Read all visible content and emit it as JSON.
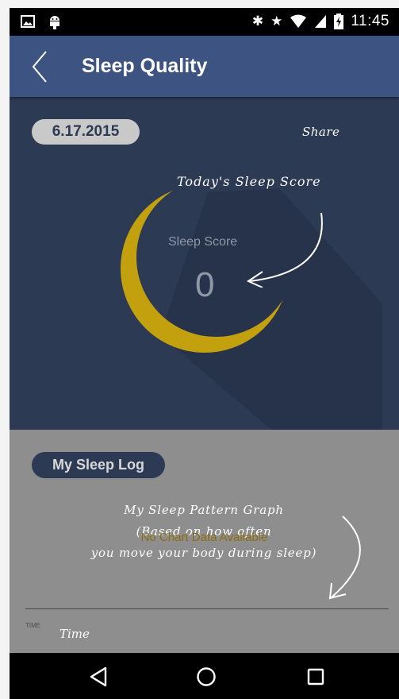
{
  "status_bar": {
    "time": "11:45",
    "icons": [
      "image-icon",
      "android-icon",
      "bluetooth-icon",
      "star-icon",
      "wifi-icon",
      "signal-icon",
      "battery-charging-icon"
    ]
  },
  "app_bar": {
    "title": "Sleep Quality",
    "back_icon": "chevron-left-icon"
  },
  "score_section": {
    "date": "6.17.2015",
    "share_label": "Share",
    "annotation": "Today's Sleep Score",
    "score_label": "Sleep Score",
    "score_value": "0"
  },
  "log_section": {
    "button_label": "My Sleep Log",
    "annotation_lines": [
      "My Sleep Pattern Graph",
      "(Based on how often",
      "you move your body during sleep)"
    ],
    "no_data_text": "No Chart Data Available",
    "axis_label": "TIME",
    "axis_annotation": "Time"
  },
  "nav_bar": {
    "icons": [
      "back-triangle-icon",
      "home-circle-icon",
      "recents-square-icon"
    ]
  },
  "colors": {
    "app_bar": "#3d5482",
    "score_bg": "#2c3a54",
    "moon": "#c2a00e",
    "log_bg": "#8e8e8e"
  }
}
